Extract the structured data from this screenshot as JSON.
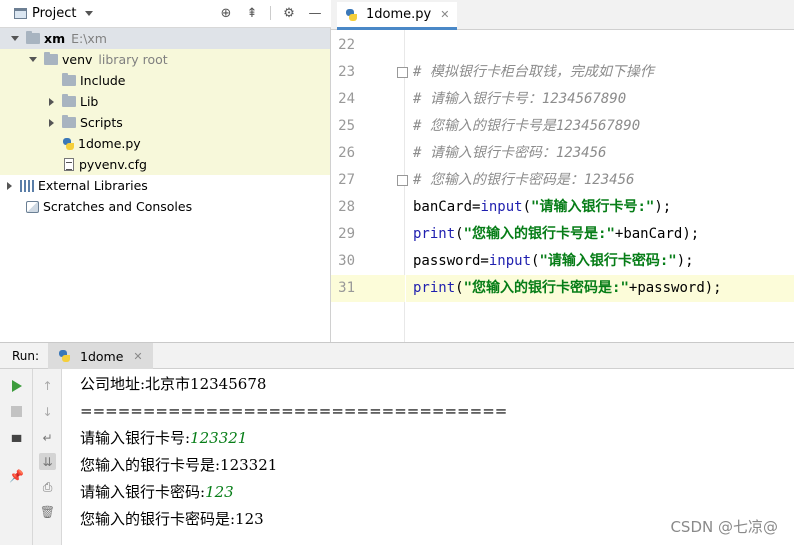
{
  "project_panel": {
    "title": "Project",
    "tree": [
      {
        "label": "xm",
        "hint": "E:\\xm",
        "icon": "folder-icon",
        "expanded": true
      },
      {
        "label": "venv",
        "hint": "library root",
        "icon": "folder-icon",
        "expanded": true
      },
      {
        "label": "Include",
        "icon": "folder-icon"
      },
      {
        "label": "Lib",
        "icon": "folder-icon",
        "expanded": false
      },
      {
        "label": "Scripts",
        "icon": "folder-icon",
        "expanded": false
      },
      {
        "label": "1dome.py",
        "icon": "python-file-icon"
      },
      {
        "label": "pyvenv.cfg",
        "icon": "config-file-icon"
      },
      {
        "label": "External Libraries",
        "icon": "library-icon",
        "expanded": false
      },
      {
        "label": "Scratches and Consoles",
        "icon": "scratches-icon"
      }
    ]
  },
  "editor": {
    "tab_label": "1dome.py",
    "line_numbers": [
      "22",
      "23",
      "24",
      "25",
      "26",
      "27",
      "28",
      "29",
      "30",
      "31"
    ],
    "lines": [
      {
        "parts": []
      },
      {
        "parts": [
          {
            "t": "# 模拟银行卡柜台取钱，完成如下操作",
            "c": "cmt"
          }
        ]
      },
      {
        "parts": [
          {
            "t": "# 请输入银行卡号：1234567890",
            "c": "cmt"
          }
        ]
      },
      {
        "parts": [
          {
            "t": "# 您输入的银行卡号是1234567890",
            "c": "cmt"
          }
        ]
      },
      {
        "parts": [
          {
            "t": "# 请输入银行卡密码：123456",
            "c": "cmt"
          }
        ]
      },
      {
        "parts": [
          {
            "t": "# 您输入的银行卡密码是：123456",
            "c": "cmt"
          }
        ]
      },
      {
        "parts": [
          {
            "t": "banCard=",
            "c": "plain"
          },
          {
            "t": "input",
            "c": "kw"
          },
          {
            "t": "(",
            "c": "plain"
          },
          {
            "t": "\"请输入银行卡号:\"",
            "c": "str"
          },
          {
            "t": ");",
            "c": "plain"
          }
        ]
      },
      {
        "parts": [
          {
            "t": "print",
            "c": "kw"
          },
          {
            "t": "(",
            "c": "plain"
          },
          {
            "t": "\"您输入的银行卡号是:\"",
            "c": "str"
          },
          {
            "t": "+banCard);",
            "c": "plain"
          }
        ]
      },
      {
        "parts": [
          {
            "t": "password=",
            "c": "plain"
          },
          {
            "t": "input",
            "c": "kw"
          },
          {
            "t": "(",
            "c": "plain"
          },
          {
            "t": "\"请输入银行卡密码:\"",
            "c": "str"
          },
          {
            "t": ");",
            "c": "plain"
          }
        ]
      },
      {
        "parts": [
          {
            "t": "print",
            "c": "kw"
          },
          {
            "t": "(",
            "c": "plain"
          },
          {
            "t": "\"您输入的银行卡密码是:\"",
            "c": "str"
          },
          {
            "t": "+password);",
            "c": "plain"
          }
        ]
      }
    ]
  },
  "run_panel": {
    "label": "Run:",
    "tab_label": "1dome",
    "console": [
      {
        "text": "公司地址:北京市12345678",
        "input": ""
      },
      {
        "text": "==================================",
        "input": ""
      },
      {
        "text": "请输入银行卡号:",
        "input": "123321"
      },
      {
        "text": "您输入的银行卡号是:123321",
        "input": ""
      },
      {
        "text": "请输入银行卡密码:",
        "input": "123"
      },
      {
        "text": "您输入的银行卡密码是:123",
        "input": ""
      }
    ]
  },
  "watermark": "CSDN @七凉@",
  "colors": {
    "comment": "#8c8c8c",
    "keyword": "#1f1faf",
    "string": "#067d17",
    "current_line": "#fcfcd9",
    "tree_highlight": "#f7f8da"
  }
}
